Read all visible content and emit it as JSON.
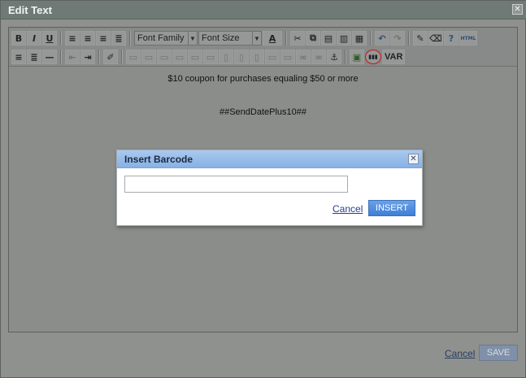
{
  "window": {
    "title": "Edit Text",
    "close_glyph": "✕"
  },
  "toolbar": {
    "font_family": "Font Family",
    "font_size": "Font Size",
    "var_label": "VAR",
    "icons": [
      "bold-icon",
      "italic-icon",
      "underline-icon",
      "align-left-icon",
      "align-center-icon",
      "align-right-icon",
      "justify-icon",
      "font-color-icon",
      "cut-icon",
      "copy-icon",
      "paste-icon",
      "paste-text-icon",
      "paste-word-icon",
      "undo-icon",
      "redo-icon",
      "cleanup-icon",
      "eraser-icon",
      "help-icon",
      "html-icon",
      "bullet-list-icon",
      "numbered-list-icon",
      "horizontal-rule-icon",
      "outdent-icon",
      "indent-icon",
      "edit-icon",
      "anchor-icon",
      "image-icon",
      "barcode-icon"
    ],
    "glyphs": {
      "bold": "B",
      "italic": "I",
      "underline": "U",
      "font_color": "A",
      "cut": "✂",
      "copy": "⧉",
      "paste": "📋",
      "undo": "↶",
      "redo": "↷",
      "help": "?",
      "html": "HTML",
      "bullets": "≡",
      "numbered": "≣",
      "hr": "—",
      "anchor": "⚓",
      "image": "▣",
      "barcode": "▮▮▮",
      "arrow": "▼"
    }
  },
  "content": {
    "line1": "$10 coupon for purchases equaling $50 or more",
    "line2": "##SendDatePlus10##"
  },
  "footer": {
    "cancel_label": "Cancel",
    "save_label": "SAVE"
  },
  "dialog": {
    "title": "Insert Barcode",
    "close_glyph": "✕",
    "input_value": "",
    "cancel_label": "Cancel",
    "insert_label": "INSERT"
  },
  "colors": {
    "dialog_title_bar": "#88b1e4",
    "insert_button": "#3f7fd6",
    "highlight_circle": "#c61818"
  }
}
